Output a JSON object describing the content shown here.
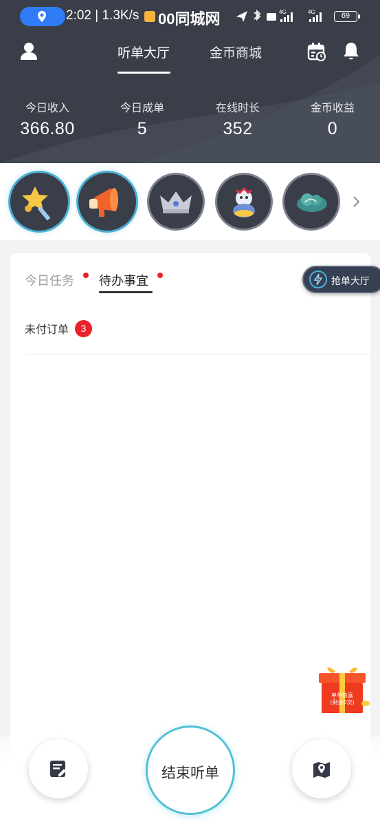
{
  "status_bar": {
    "time": "2:02",
    "speed": "1.3K/s",
    "app_name": "00同城网",
    "network_1": "4G",
    "network_2": "4G",
    "battery": "69"
  },
  "nav": {
    "tabs": [
      {
        "label": "听单大厅",
        "active": true
      },
      {
        "label": "金币商城",
        "active": false
      }
    ]
  },
  "stats": [
    {
      "label": "今日收入",
      "value": "366.80"
    },
    {
      "label": "今日成单",
      "value": "5"
    },
    {
      "label": "在线时长",
      "value": "352"
    },
    {
      "label": "金币收益",
      "value": "0"
    }
  ],
  "badges": [
    {
      "icon": "magic-wand-icon",
      "active": true
    },
    {
      "icon": "megaphone-icon",
      "active": true
    },
    {
      "icon": "crown-icon",
      "active": false
    },
    {
      "icon": "mascot-icon",
      "active": false
    },
    {
      "icon": "cloud-icon",
      "active": false
    }
  ],
  "content": {
    "tabs": [
      {
        "label": "今日任务",
        "active": false
      },
      {
        "label": "待办事宜",
        "active": true
      }
    ],
    "rows": [
      {
        "label": "未付订单",
        "count": "3"
      }
    ]
  },
  "grab_hall": {
    "label": "抢单大厅"
  },
  "gift": {
    "line1": "单单惊喜",
    "line2": "(剩余0次)"
  },
  "bottom": {
    "end_button": "结束听单",
    "left_icon": "edit-note-icon",
    "right_icon": "map-marker-icon"
  },
  "colors": {
    "header_bg": "#3a3e48",
    "accent_blue": "#2f7cf6",
    "accent_teal": "#52c1d6",
    "badge_red": "#e8212a"
  }
}
